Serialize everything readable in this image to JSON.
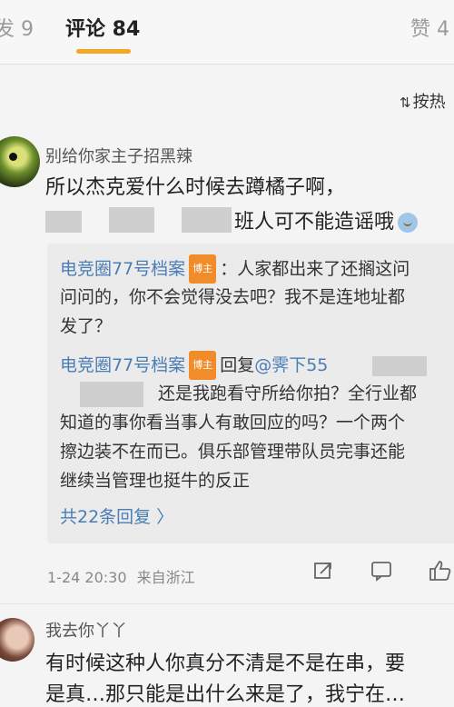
{
  "tabs": {
    "left": "发 9",
    "main": "评论 84",
    "right": "赞 4"
  },
  "sort": {
    "icon": "sort-icon",
    "label": "按热"
  },
  "comment1": {
    "name": "别给你家主子招黑辣",
    "line1": "所以杰克爱什么时候去蹲橘子啊，",
    "line2_tail": "班人可不能造谣哦",
    "replies": [
      {
        "author": "电竞圈77号档案",
        "badge": "博主",
        "text": "：人家都出来了还搁这问",
        "cont": [
          "问问的，你不会觉得没去吧？我不是连地址都",
          "发了？"
        ]
      },
      {
        "author": "电竞圈77号档案",
        "badge": "博主",
        "reply_prefix": "回复",
        "reply_to": "@霁下55",
        "cont_tail": "还是我跑看守所给你拍？全行业都",
        "cont": [
          "知道的事你看当事人有敢回应的吗？一个两个",
          "擦边装不在而已。俱乐部管理带队员完事还能",
          "继续当管理也挺牛的反正"
        ]
      }
    ],
    "more": "共22条回复 〉",
    "time": "1-24 20:30",
    "location": "来自浙江"
  },
  "comment2": {
    "name": "我去你丫丫",
    "line1": "有时候这种人你真分不清是不是在串，要",
    "line2": "是真…那只能是出什么来是了，我宁在…"
  }
}
